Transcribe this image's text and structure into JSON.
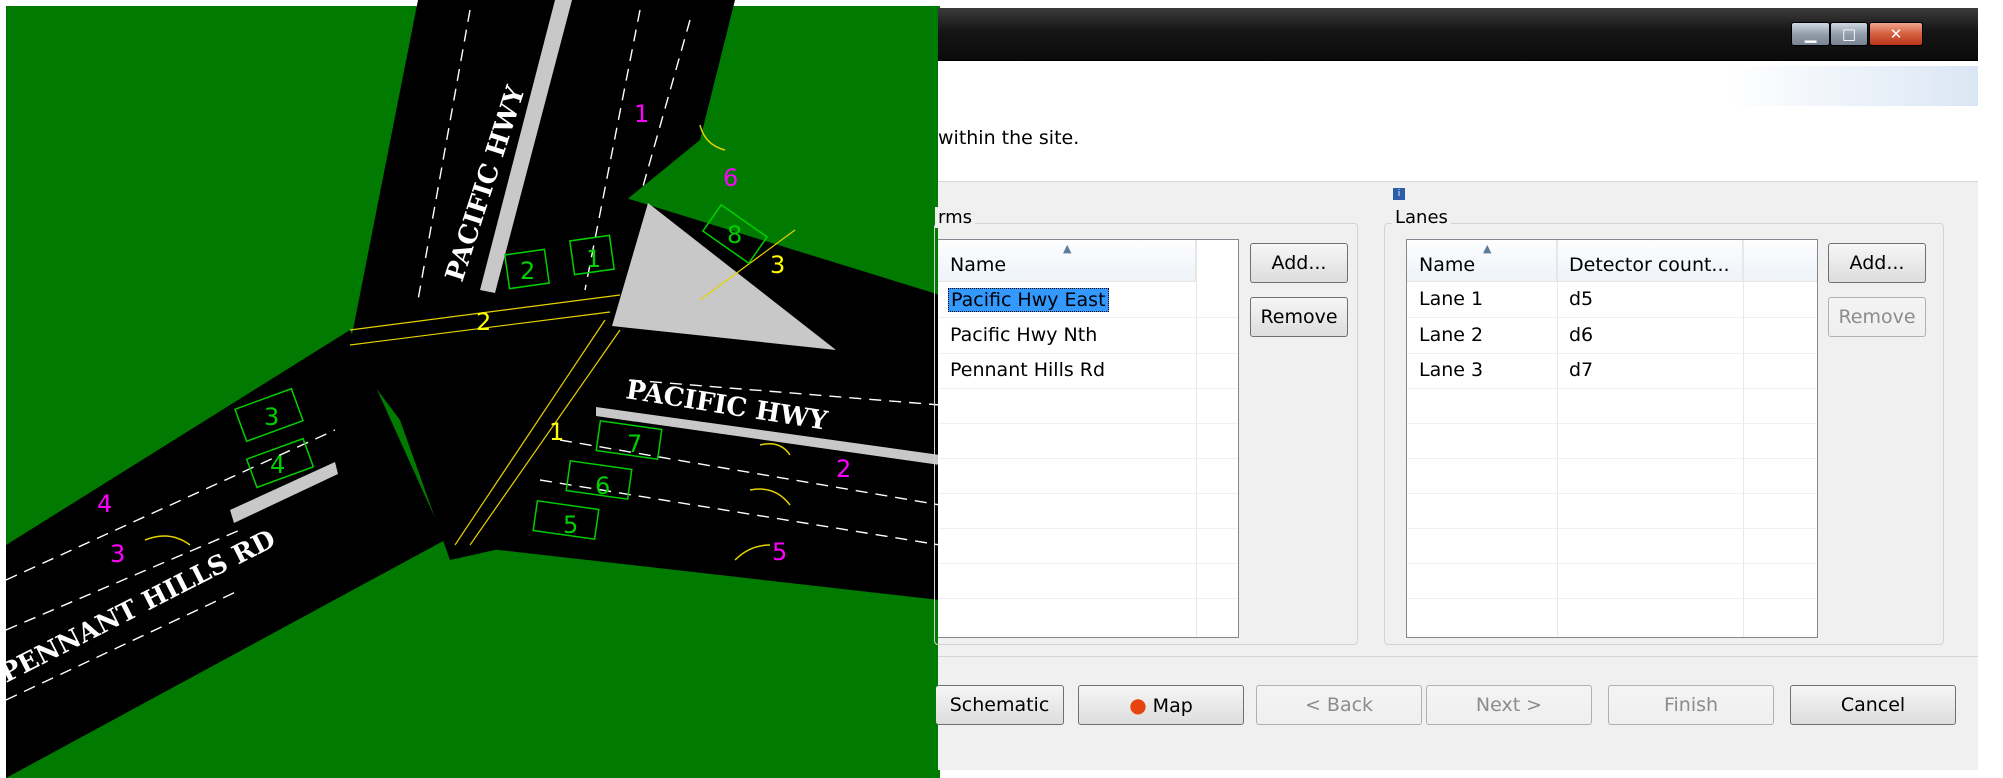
{
  "map": {
    "road_names": [
      "PACIFIC HWY",
      "PACIFIC HWY",
      "PENNANT HILLS RD"
    ],
    "approach_numbers": [
      "1",
      "2",
      "3",
      "4",
      "5",
      "6"
    ],
    "arm_numbers": [
      "1",
      "2",
      "3"
    ],
    "detector_numbers": [
      "1",
      "2",
      "3",
      "4",
      "5",
      "6",
      "7",
      "8"
    ],
    "colors": {
      "grass": "#007a00",
      "road": "#000000",
      "detector": "#00d000",
      "approach": "#ff00ff",
      "arm": "#ffff00"
    }
  },
  "dialog": {
    "description": "within the site.",
    "arms": {
      "group_label": "rms",
      "header": "Name",
      "rows": [
        "Pacific Hwy East",
        "Pacific Hwy Nth",
        "Pennant Hills Rd"
      ],
      "selected_index": 0,
      "add_label": "Add...",
      "remove_label": "Remove"
    },
    "lanes": {
      "group_label": "Lanes",
      "headers": [
        "Name",
        "Detector count..."
      ],
      "rows": [
        {
          "name": "Lane 1",
          "detector": "d5"
        },
        {
          "name": "Lane 2",
          "detector": "d6"
        },
        {
          "name": "Lane 3",
          "detector": "d7"
        }
      ],
      "add_label": "Add...",
      "remove_label": "Remove"
    },
    "footer": {
      "schematic": "Schematic",
      "map": "Map",
      "back": "< Back",
      "next": "Next >",
      "finish": "Finish",
      "cancel": "Cancel"
    }
  }
}
